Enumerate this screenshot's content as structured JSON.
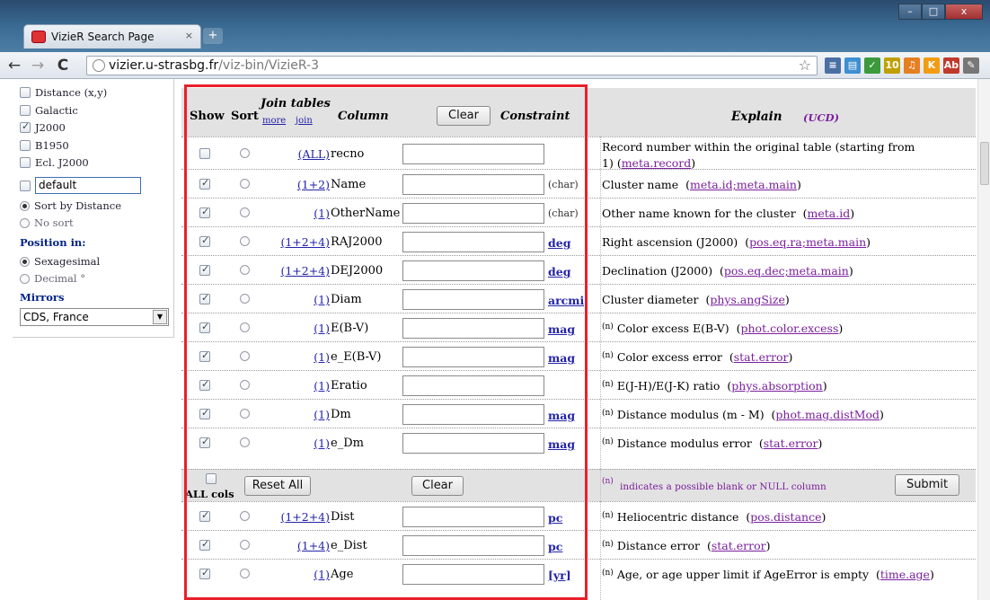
{
  "browser": {
    "tab_title": "VizieR Search Page",
    "tab_close": "×",
    "new_tab": "+",
    "url_domain": "vizier.u-strasbg.fr",
    "url_path": "/viz-bin/VizieR-3",
    "back": "←",
    "forward": "→",
    "reload": "C",
    "star": "☆",
    "window_controls": [
      "–",
      "□",
      "x"
    ],
    "extensions": [
      {
        "name": "rss",
        "label": "≡",
        "color": "#4a6fa5"
      },
      {
        "name": "bookmarks",
        "label": "▤",
        "color": "#3d8fd1"
      },
      {
        "name": "check",
        "label": "✓",
        "color": "#3c9a3c"
      },
      {
        "name": "date",
        "label": "10",
        "color": "#c0a000"
      },
      {
        "name": "music",
        "label": "♫",
        "color": "#e67e22"
      },
      {
        "name": "k",
        "label": "K",
        "color": "#f39c12"
      },
      {
        "name": "ab",
        "label": "Ab",
        "color": "#c0392b"
      },
      {
        "name": "wrench",
        "label": "✎",
        "color": "#777777"
      }
    ]
  },
  "sidebar": {
    "distance_label": "Distance (x,y)",
    "galactic_label": "Galactic",
    "j2000_label": "J2000",
    "b1950_label": "B1950",
    "eclj2000_label": "Ecl. J2000",
    "default_value": "default",
    "sort_distance_label": "Sort by Distance",
    "no_sort_label": "No sort",
    "position_heading": "Position in:",
    "sexagesimal_label": "Sexagesimal",
    "decimal_label": "Decimal °",
    "mirrors_heading": "Mirrors",
    "mirror_selected": "CDS, France"
  },
  "header": {
    "show": "Show",
    "sort": "Sort",
    "join_tables": "Join tables",
    "more": "more",
    "join": "join",
    "column": "Column",
    "clear": "Clear",
    "constraint": "Constraint",
    "explain": "Explain",
    "ucd": "(UCD)"
  },
  "rows_top": [
    {
      "checked": false,
      "link": "(ALL)",
      "name": "recno",
      "unit": "",
      "unit_type": "none",
      "null": false,
      "exp": "Record number within the original table (starting from",
      "exp2_pre": "1)",
      "ucd": "meta.record"
    },
    {
      "checked": true,
      "link": "(1+2)",
      "name": "Name",
      "unit": "(char)",
      "unit_type": "plain",
      "null": false,
      "exp": "Cluster name",
      "ucd": "meta.id;meta.main"
    },
    {
      "checked": true,
      "link": "(1)",
      "name": "OtherName",
      "unit": "(char)",
      "unit_type": "plain",
      "null": false,
      "exp": "Other name known for the cluster",
      "ucd": "meta.id"
    },
    {
      "checked": true,
      "link": "(1+2+4)",
      "name": "RAJ2000",
      "unit": "deg",
      "unit_type": "link",
      "null": false,
      "exp": "Right ascension (J2000)",
      "ucd": "pos.eq.ra;meta.main"
    },
    {
      "checked": true,
      "link": "(1+2+4)",
      "name": "DEJ2000",
      "unit": "deg",
      "unit_type": "link",
      "null": false,
      "exp": "Declination (J2000)",
      "ucd": "pos.eq.dec;meta.main"
    },
    {
      "checked": true,
      "link": "(1)",
      "name": "Diam",
      "unit": "arcmin",
      "unit_type": "link",
      "null": false,
      "exp": "Cluster diameter",
      "ucd": "phys.angSize"
    },
    {
      "checked": true,
      "link": "(1)",
      "name": "E(B-V)",
      "unit": "mag",
      "unit_type": "link",
      "null": true,
      "exp": "Color excess E(B-V)",
      "ucd": "phot.color.excess"
    },
    {
      "checked": true,
      "link": "(1)",
      "name": "e_E(B-V)",
      "unit": "mag",
      "unit_type": "link",
      "null": true,
      "exp": "Color excess error",
      "ucd": "stat.error"
    },
    {
      "checked": true,
      "link": "(1)",
      "name": "Eratio",
      "unit": "",
      "unit_type": "none",
      "null": true,
      "exp": "E(J-H)/E(J-K) ratio",
      "ucd": "phys.absorption"
    },
    {
      "checked": true,
      "link": "(1)",
      "name": "Dm",
      "unit": "mag",
      "unit_type": "link",
      "null": true,
      "exp": "Distance modulus (m - M)",
      "ucd": "phot.mag.distMod"
    },
    {
      "checked": true,
      "link": "(1)",
      "name": "e_Dm",
      "unit": "mag",
      "unit_type": "link",
      "null": true,
      "exp": "Distance modulus error",
      "ucd": "stat.error"
    }
  ],
  "midbar": {
    "all_cols": "ALL cols",
    "reset_all": "Reset All",
    "clear": "Clear",
    "null_marker": "(n)",
    "null_note": "indicates a possible blank or NULL column",
    "submit": "Submit"
  },
  "rows_bottom": [
    {
      "checked": true,
      "link": "(1+2+4)",
      "name": "Dist",
      "unit": "pc",
      "unit_type": "link",
      "null": true,
      "exp": "Heliocentric distance",
      "ucd": "pos.distance"
    },
    {
      "checked": true,
      "link": "(1+4)",
      "name": "e_Dist",
      "unit": "pc",
      "unit_type": "link",
      "null": true,
      "exp": "Distance error",
      "ucd": "stat.error"
    },
    {
      "checked": true,
      "link": "(1)",
      "name": "Age",
      "unit": "[yr]",
      "unit_type": "link",
      "null": true,
      "exp": "Age, or age upper limit if AgeError is empty",
      "ucd": "time.age"
    }
  ],
  "colors": {
    "highlight": "#e8202a",
    "link": "#2323aa",
    "ucd": "#7a1f9c",
    "header_bg": "#e2e2e2"
  }
}
